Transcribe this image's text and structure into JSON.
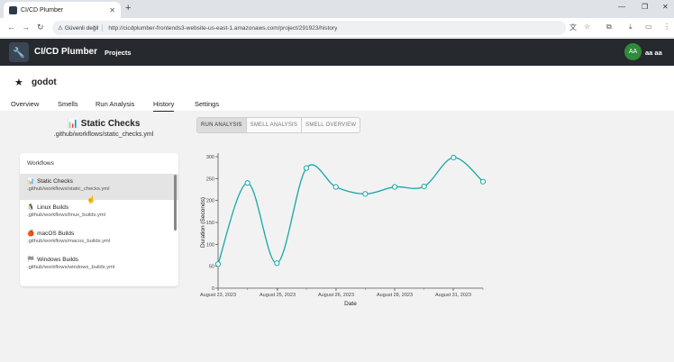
{
  "browser": {
    "tab_title": "CI/CD Plumber",
    "secure_label": "Güvenli değil",
    "url": "http://cicdplumber-frontends3-website-us-east-1.amazonaws.com/project/291923/history"
  },
  "app": {
    "brand": "CI/CD Plumber",
    "nav_projects": "Projects",
    "avatar_initials": "AA",
    "user_name": "aa aa"
  },
  "project": {
    "name": "godot",
    "tabs": [
      {
        "label": "Overview"
      },
      {
        "label": "Smells"
      },
      {
        "label": "Run Analysis"
      },
      {
        "label": "History",
        "active": true
      },
      {
        "label": "Settings"
      }
    ]
  },
  "check": {
    "title": "📊 Static Checks",
    "path": ".github/workflows/static_checks.yml"
  },
  "workflows": {
    "header": "Workflows",
    "items": [
      {
        "icon": "📊",
        "name": "Static Checks",
        "file": ".github/workflows/static_checks.yml",
        "selected": true
      },
      {
        "icon": "🐧",
        "name": "Linux Builds",
        "file": ".github/workflows/linux_builds.yml"
      },
      {
        "icon": "🍎",
        "name": "macOS Builds",
        "file": ".github/workflows/macos_builds.yml"
      },
      {
        "icon": "🏁",
        "name": "Windows Builds",
        "file": ".github/workflows/windows_builds.yml"
      }
    ]
  },
  "view_toggle": {
    "options": [
      "RUN ANALYSIS",
      "SMELL ANALYSIS",
      "SMELL OVERVIEW"
    ],
    "selected": "RUN ANALYSIS"
  },
  "chart_data": {
    "type": "line",
    "xlabel": "Date",
    "ylabel": "Duration (Seconds)",
    "ylim": [
      0,
      300
    ],
    "yticks": [
      0,
      50,
      100,
      150,
      200,
      250,
      300
    ],
    "xticks": [
      "August 23, 2023",
      "August 25, 2023",
      "August 26, 2023",
      "August 28, 2023",
      "August 31, 2023"
    ],
    "series": [
      {
        "values": [
          55,
          240,
          57,
          274,
          231,
          215,
          231,
          232,
          298,
          243
        ]
      }
    ],
    "color": "#1aa6a6",
    "grid": false
  }
}
